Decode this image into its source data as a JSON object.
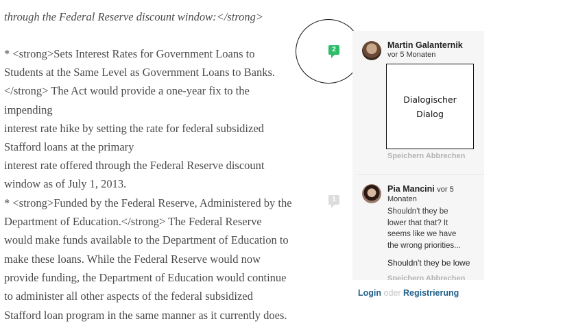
{
  "document": {
    "top_fragment": "...",
    "lines": [
      {
        "text": "through the Federal Reserve discount window:</strong>",
        "italic": true
      },
      {
        "text": "* <strong>Sets Interest Rates for Government Loans to"
      },
      {
        "text": "Students at the Same Level as Government Loans to Banks."
      },
      {
        "text": "</strong> The Act would provide a one-year fix to the"
      },
      {
        "text": "impending"
      },
      {
        "text": "interest rate hike by setting the rate for federal subsidized"
      },
      {
        "text": "Stafford loans at the primary"
      },
      {
        "text": "interest rate offered through the Federal Reserve discount"
      },
      {
        "text": "window as of July 1, 2013."
      },
      {
        "text": "* <strong>Funded by the Federal Reserve, Administered by the"
      },
      {
        "text": "Department of Education.</strong> The Federal Reserve"
      },
      {
        "text": "would make funds available to the Department of Education to"
      },
      {
        "text": "make these loans. While the Federal Reserve would now"
      },
      {
        "text": "provide funding, the Department of Education would continue"
      },
      {
        "text": "to administer all other aspects of the federal subsidized"
      },
      {
        "text": "Stafford loan program in the same manner as it currently does."
      }
    ]
  },
  "badges": {
    "active_count": "2",
    "inactive_count": "1",
    "active_color": "#2ebd6b",
    "inactive_color": "#dcdcdc"
  },
  "comments": [
    {
      "author": "Martin Galanternik",
      "time": "vor 5 Monaten",
      "dialog_line1": "Dialogischer",
      "dialog_line2": "Dialog",
      "save": "Speichern",
      "cancel": "Abbrechen"
    },
    {
      "author": "Pia Mancini",
      "time_part1": "vor 5",
      "time_part2": "Monaten",
      "text_lines": [
        "Shouldn't they be",
        "lower that that? It",
        "seems like we have",
        "the wrong priorities..."
      ],
      "reply_text": "Shouldn't they be lowe",
      "save": "Speichern",
      "cancel": "Abbrechen"
    }
  ],
  "auth": {
    "login": "Login",
    "or": "oder",
    "register": "Registrierung"
  },
  "colors": {
    "link": "#1f5f8a",
    "panel": "#f6f6f6"
  }
}
